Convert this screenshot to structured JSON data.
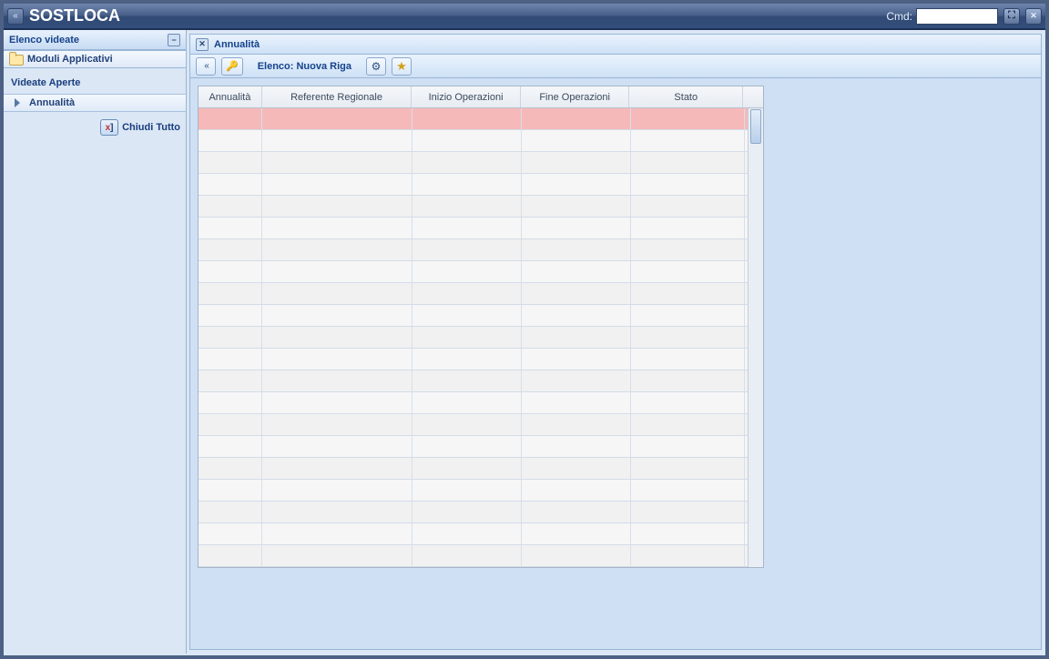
{
  "app": {
    "title": "SOSTLOCA"
  },
  "header": {
    "cmd_label": "Cmd:",
    "cmd_value": ""
  },
  "sidebar": {
    "title": "Elenco videate",
    "module_label": "Moduli Applicativi",
    "open_section": "Videate Aperte",
    "open_item": "Annualità",
    "close_all": "Chiudi Tutto"
  },
  "panel": {
    "title": "Annualità",
    "toolbar_label": "Elenco: Nuova Riga"
  },
  "grid": {
    "columns": [
      "Annualità",
      "Referente Regionale",
      "Inizio Operazioni",
      "Fine Operazioni",
      "Stato"
    ],
    "rows": [
      [
        "",
        "",
        "",
        "",
        ""
      ],
      [
        "",
        "",
        "",
        "",
        ""
      ],
      [
        "",
        "",
        "",
        "",
        ""
      ],
      [
        "",
        "",
        "",
        "",
        ""
      ],
      [
        "",
        "",
        "",
        "",
        ""
      ],
      [
        "",
        "",
        "",
        "",
        ""
      ],
      [
        "",
        "",
        "",
        "",
        ""
      ],
      [
        "",
        "",
        "",
        "",
        ""
      ],
      [
        "",
        "",
        "",
        "",
        ""
      ],
      [
        "",
        "",
        "",
        "",
        ""
      ],
      [
        "",
        "",
        "",
        "",
        ""
      ],
      [
        "",
        "",
        "",
        "",
        ""
      ],
      [
        "",
        "",
        "",
        "",
        ""
      ],
      [
        "",
        "",
        "",
        "",
        ""
      ],
      [
        "",
        "",
        "",
        "",
        ""
      ],
      [
        "",
        "",
        "",
        "",
        ""
      ],
      [
        "",
        "",
        "",
        "",
        ""
      ],
      [
        "",
        "",
        "",
        "",
        ""
      ],
      [
        "",
        "",
        "",
        "",
        ""
      ],
      [
        "",
        "",
        "",
        "",
        ""
      ],
      [
        "",
        "",
        "",
        "",
        ""
      ]
    ],
    "selected_row": 0
  }
}
